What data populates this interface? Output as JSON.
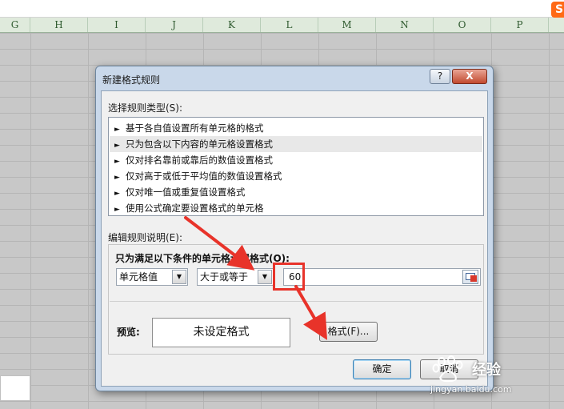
{
  "spreadsheet": {
    "columns": [
      "G",
      "H",
      "I",
      "J",
      "K",
      "L",
      "M",
      "N",
      "O",
      "P"
    ],
    "logo_text": "S"
  },
  "dialog": {
    "title": "新建格式规则",
    "help_label": "?",
    "close_label": "X",
    "rule_type_label": "选择规则类型(S):",
    "rule_types": [
      "基于各自值设置所有单元格的格式",
      "只为包含以下内容的单元格设置格式",
      "仅对排名靠前或靠后的数值设置格式",
      "仅对高于或低于平均值的数值设置格式",
      "仅对唯一值或重复值设置格式",
      "使用公式确定要设置格式的单元格"
    ],
    "selected_rule_index": 1,
    "rule_desc_label": "编辑规则说明(E):",
    "condition_label": "只为满足以下条件的单元格设置格式(O):",
    "cell_combo_value": "单元格值",
    "operator_combo_value": "大于或等于",
    "value_input": "60",
    "preview_label": "预览:",
    "preview_text": "未设定格式",
    "format_button": "格式(F)...",
    "ok_button": "确定",
    "cancel_button": "取消"
  },
  "watermark": {
    "brand": "经验",
    "site": "jingyan.baidu.com"
  },
  "colors": {
    "dialog_frame": "#c9d8ea",
    "annotation_red": "#e8332a",
    "column_header": "#dfeadc"
  }
}
